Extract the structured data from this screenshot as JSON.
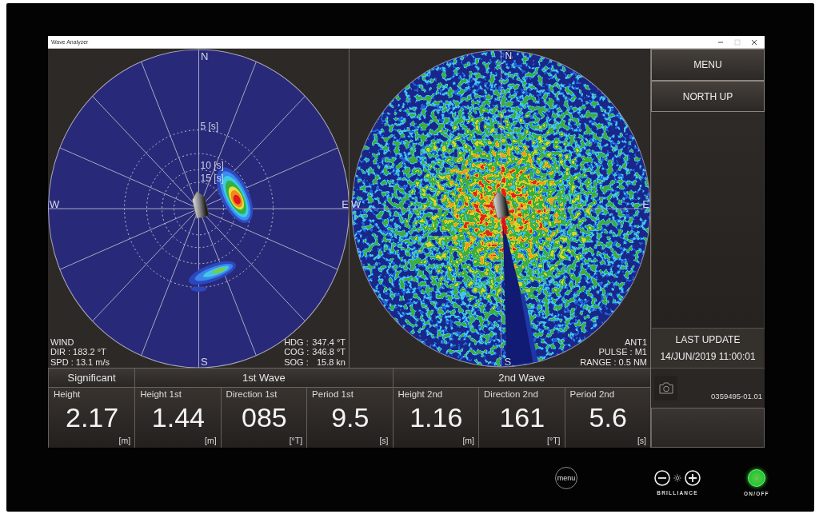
{
  "window": {
    "title": "Wave Analyzer"
  },
  "wave_spectrum": {
    "compass": {
      "north": "N",
      "east": "E",
      "south": "S",
      "west": "W"
    },
    "period_rings": [
      "5 [s]",
      "10 [s]",
      "15 [s]"
    ],
    "wind": [
      "WIND",
      "DIR : 183.2 °T",
      "SPD : 13.1 m/s"
    ],
    "navigation": [
      {
        "label": "HDG :",
        "value": "347.4 °T"
      },
      {
        "label": "COG :",
        "value": "346.8 °T"
      },
      {
        "label": "SOG :",
        "value": "15.8 kn"
      }
    ]
  },
  "radar_image": {
    "compass": {
      "north": "N",
      "east": "E",
      "south": "S",
      "west": "W"
    },
    "info": [
      "ANT1",
      "PULSE : M1",
      "RANGE : 0.5 NM"
    ]
  },
  "side_panel": {
    "buttons": [
      {
        "label": "MENU"
      },
      {
        "label": "NORTH UP"
      }
    ],
    "last_update": {
      "label": "LAST UPDATE",
      "time": "14/JUN/2019 11:00:01"
    },
    "version": "0359495-01.01"
  },
  "wave_table": [
    {
      "label": "Significant",
      "cells": [
        {
          "label": "Height",
          "value": "2.17",
          "unit": "[m]"
        }
      ]
    },
    {
      "label": "1st Wave",
      "cells": [
        {
          "label": "Height 1st",
          "value": "1.44",
          "unit": "[m]"
        },
        {
          "label": "Direction 1st",
          "value": "085",
          "unit": "[°T]"
        },
        {
          "label": "Period 1st",
          "value": "9.5",
          "unit": "[s]"
        }
      ]
    },
    {
      "label": "2nd Wave",
      "cells": [
        {
          "label": "Height 2nd",
          "value": "1.16",
          "unit": "[m]"
        },
        {
          "label": "Direction 2nd",
          "value": "161",
          "unit": "[°T]"
        },
        {
          "label": "Period 2nd",
          "value": "5.6",
          "unit": "[s]"
        }
      ]
    }
  ],
  "bezel": {
    "menu_key": "menu",
    "brilliance_label": "BRILLIANCE",
    "power": {
      "label": "ON/OFF",
      "on": true
    }
  }
}
